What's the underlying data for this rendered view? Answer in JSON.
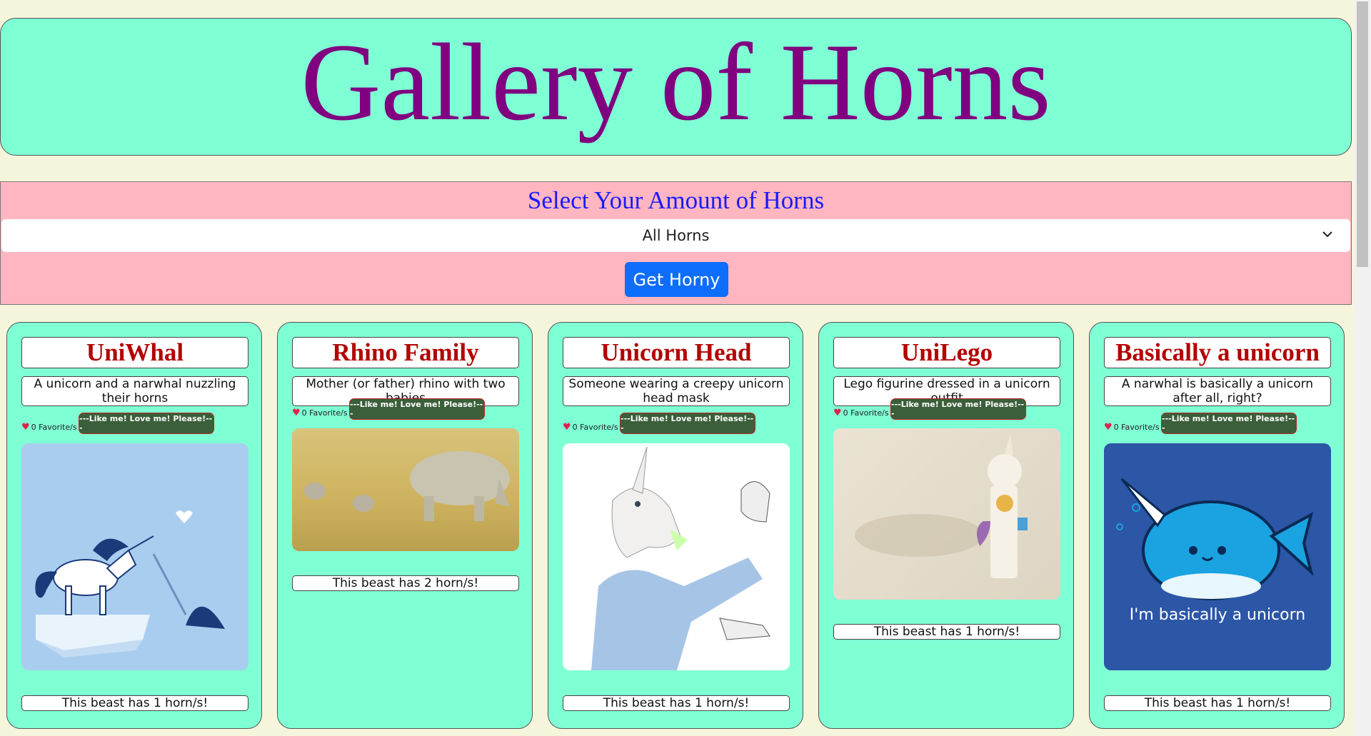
{
  "header": {
    "title": "Gallery of Horns"
  },
  "filter": {
    "label": "Select Your Amount of Horns",
    "selected": "All Horns",
    "button_label": "Get Horny"
  },
  "cards": [
    {
      "title": "UniWhal",
      "description": "A unicorn and a narwhal nuzzling their horns",
      "favorites": "0 Favorite/s",
      "like_label": "---Like me! Love me! Please!---",
      "horns_text": "This beast has 1 horn/s!",
      "image_icon": "unicorn-narwhal-illustration"
    },
    {
      "title": "Rhino Family",
      "description": "Mother (or father) rhino with two babies",
      "favorites": "0 Favorite/s",
      "like_label": "---Like me! Love me! Please!---",
      "horns_text": "This beast has 2 horn/s!",
      "image_icon": "rhino-family-photo"
    },
    {
      "title": "Unicorn Head",
      "description": "Someone wearing a creepy unicorn head mask",
      "favorites": "0 Favorite/s",
      "like_label": "---Like me! Love me! Please!---",
      "horns_text": "This beast has 1 horn/s!",
      "image_icon": "unicorn-mask-photo"
    },
    {
      "title": "UniLego",
      "description": "Lego figurine dressed in a unicorn outfit",
      "favorites": "0 Favorite/s",
      "like_label": "---Like me! Love me! Please!---",
      "horns_text": "This beast has 1 horn/s!",
      "image_icon": "lego-unicorn-photo"
    },
    {
      "title": "Basically a unicorn",
      "description": "A narwhal is basically a unicorn after all, right?",
      "favorites": "0 Favorite/s",
      "like_label": "---Like me! Love me! Please!---",
      "horns_text": "This beast has 1 horn/s!",
      "image_icon": "narwhal-cartoon",
      "image_caption": "I'm basically a unicorn"
    }
  ]
}
